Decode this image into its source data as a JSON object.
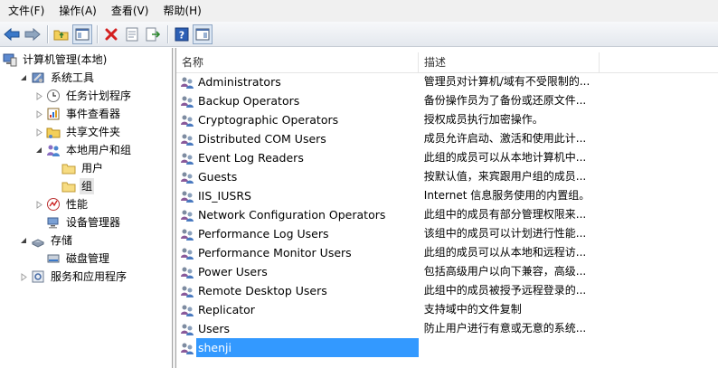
{
  "menu": [
    "文件(F)",
    "操作(A)",
    "查看(V)",
    "帮助(H)"
  ],
  "toolbar": [
    "back-arrow-icon",
    "forward-arrow-icon",
    "up-folder-icon",
    "show-hide-tree-icon",
    "delete-icon",
    "properties-icon",
    "export-list-icon",
    "help-icon",
    "action-pane-icon"
  ],
  "tree": [
    {
      "label": "计算机管理(本地)",
      "icon": "computer-management-icon",
      "indent": 0,
      "expander": ""
    },
    {
      "label": "系统工具",
      "icon": "tools-icon",
      "indent": 1,
      "expander": "open"
    },
    {
      "label": "任务计划程序",
      "icon": "clock-icon",
      "indent": 2,
      "expander": "closed"
    },
    {
      "label": "事件查看器",
      "icon": "event-viewer-icon",
      "indent": 2,
      "expander": "closed"
    },
    {
      "label": "共享文件夹",
      "icon": "shared-folder-icon",
      "indent": 2,
      "expander": "closed"
    },
    {
      "label": "本地用户和组",
      "icon": "users-icon",
      "indent": 2,
      "expander": "open"
    },
    {
      "label": "用户",
      "icon": "folder-icon",
      "indent": 3,
      "expander": ""
    },
    {
      "label": "组",
      "icon": "folder-icon",
      "indent": 3,
      "expander": "",
      "selected": true
    },
    {
      "label": "性能",
      "icon": "performance-icon",
      "indent": 2,
      "expander": "closed"
    },
    {
      "label": "设备管理器",
      "icon": "device-manager-icon",
      "indent": 2,
      "expander": ""
    },
    {
      "label": "存储",
      "icon": "storage-icon",
      "indent": 1,
      "expander": "open"
    },
    {
      "label": "磁盘管理",
      "icon": "disk-management-icon",
      "indent": 2,
      "expander": ""
    },
    {
      "label": "服务和应用程序",
      "icon": "services-icon",
      "indent": 1,
      "expander": "closed"
    }
  ],
  "list": {
    "columns": {
      "name": "名称",
      "description": "描述"
    },
    "rows": [
      {
        "name": "Administrators",
        "description": "管理员对计算机/域有不受限制的..."
      },
      {
        "name": "Backup Operators",
        "description": "备份操作员为了备份或还原文件..."
      },
      {
        "name": "Cryptographic Operators",
        "description": "授权成员执行加密操作。"
      },
      {
        "name": "Distributed COM Users",
        "description": "成员允许启动、激活和使用此计..."
      },
      {
        "name": "Event Log Readers",
        "description": "此组的成员可以从本地计算机中..."
      },
      {
        "name": "Guests",
        "description": "按默认值，来宾跟用户组的成员..."
      },
      {
        "name": "IIS_IUSRS",
        "description": "Internet 信息服务使用的内置组。"
      },
      {
        "name": "Network Configuration Operators",
        "description": "此组中的成员有部分管理权限来..."
      },
      {
        "name": "Performance Log Users",
        "description": "该组中的成员可以计划进行性能..."
      },
      {
        "name": "Performance Monitor Users",
        "description": "此组的成员可以从本地和远程访..."
      },
      {
        "name": "Power Users",
        "description": "包括高级用户以向下兼容，高级..."
      },
      {
        "name": "Remote Desktop Users",
        "description": "此组中的成员被授予远程登录的..."
      },
      {
        "name": "Replicator",
        "description": "支持域中的文件复制"
      },
      {
        "name": "Users",
        "description": "防止用户进行有意或无意的系统..."
      },
      {
        "name": "shenji",
        "description": "",
        "selected": true
      }
    ]
  }
}
